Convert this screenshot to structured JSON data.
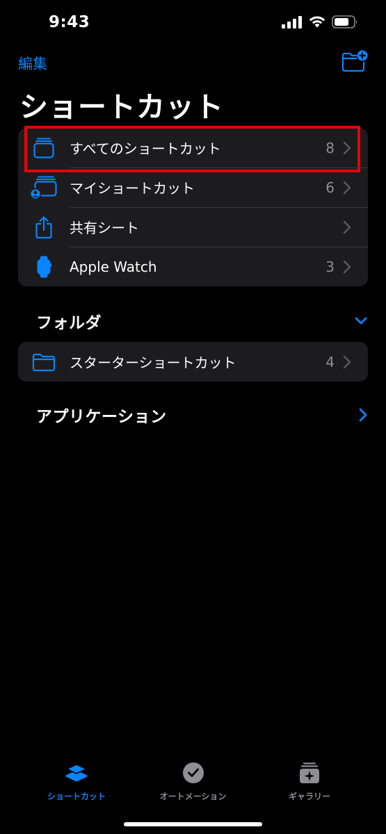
{
  "status_bar": {
    "time": "9:43"
  },
  "nav": {
    "edit_label": "編集"
  },
  "page": {
    "title": "ショートカット"
  },
  "main_list": [
    {
      "label": "すべてのショートカット",
      "count": "8",
      "icon": "all-shortcuts-icon"
    },
    {
      "label": "マイショートカット",
      "count": "6",
      "icon": "my-shortcuts-icon"
    },
    {
      "label": "共有シート",
      "count": "",
      "icon": "share-icon"
    },
    {
      "label": "Apple Watch",
      "count": "3",
      "icon": "watch-icon"
    }
  ],
  "folders_section": {
    "title": "フォルダ",
    "items": [
      {
        "label": "スターターショートカット",
        "count": "4",
        "icon": "folder-icon"
      }
    ]
  },
  "apps_section": {
    "title": "アプリケーション"
  },
  "tab_bar": [
    {
      "label": "ショートカット",
      "icon": "shortcuts-layers-icon",
      "active": true
    },
    {
      "label": "オートメーション",
      "icon": "automation-clock-icon",
      "active": false
    },
    {
      "label": "ギャラリー",
      "icon": "gallery-sparkle-icon",
      "active": false
    }
  ],
  "colors": {
    "accent": "#0a84ff",
    "background": "#000000",
    "cell_background": "#1c1c1e",
    "highlight": "#e8000b",
    "secondary_text": "#8e8e93"
  }
}
